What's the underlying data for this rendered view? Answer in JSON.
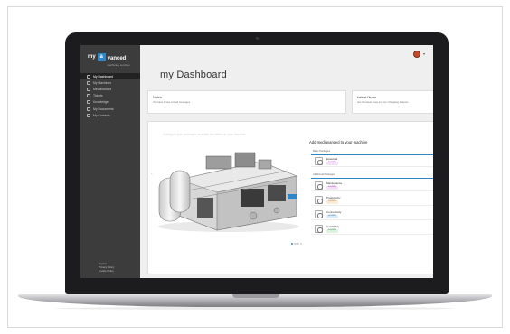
{
  "app": {
    "logo_my": "my",
    "logo_mark": "a",
    "logo_name": "vanced",
    "logo_tagline": "machinery services",
    "page_title": "my Dashboard"
  },
  "sidebar": {
    "items": [
      {
        "label": "My Dashboard",
        "icon": "dashboard-icon",
        "active": true
      },
      {
        "label": "My Machines",
        "icon": "machine-icon"
      },
      {
        "label": "Mediavanced",
        "icon": "media-icon"
      },
      {
        "label": "Tickets",
        "icon": "ticket-icon"
      },
      {
        "label": "Knowledge",
        "icon": "knowledge-icon"
      },
      {
        "label": "My Documents",
        "icon": "document-icon"
      },
      {
        "label": "My Contacts",
        "icon": "contacts-icon"
      }
    ],
    "footer": [
      "Imprint",
      "Privacy Policy",
      "Cookie Policy"
    ]
  },
  "cards": {
    "notes": {
      "title": "Notes",
      "subtitle": "You have 3 new unread messages"
    },
    "news": {
      "title": "Latest News",
      "subtitle": "Get the latest news and our changelog features"
    }
  },
  "machine": {
    "caption": "Configure your packages and see the effect on your machine"
  },
  "packages": {
    "title": "Add mediavanced to your machine",
    "basic_label": "Basic Packages",
    "basic": [
      {
        "name": "Essential",
        "tag": "available",
        "tag_color": "#b25bc4",
        "tag_bg": "#f3e2f7"
      }
    ],
    "additional_label": "Additional Packages",
    "additional": [
      {
        "name": "Maintenance",
        "tag": "available",
        "tag_color": "#b25bc4",
        "tag_bg": "#f3e2f7"
      },
      {
        "name": "Productivity",
        "tag": "available",
        "tag_color": "#d68a3a",
        "tag_bg": "#fbecd9"
      },
      {
        "name": "Connectivity",
        "tag": "available",
        "tag_color": "#4b86c6",
        "tag_bg": "#dcebfa"
      },
      {
        "name": "Availability",
        "tag": "available",
        "tag_color": "#4fa55a",
        "tag_bg": "#ddf2df"
      }
    ]
  },
  "colors": {
    "accent": "#2f86c7",
    "sidebar": "#3c3c3c"
  }
}
